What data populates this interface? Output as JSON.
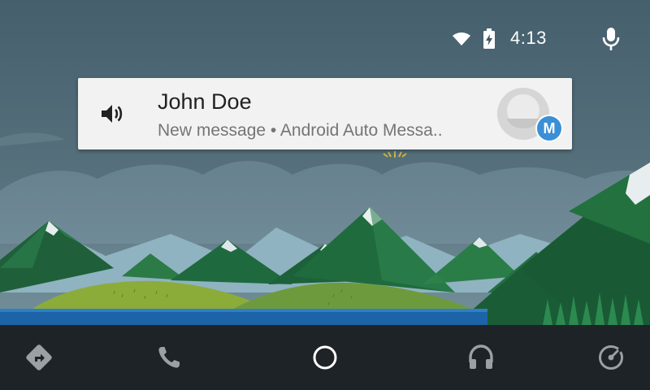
{
  "status_bar": {
    "time": "4:13",
    "icons": [
      "wifi-icon",
      "battery-charging-icon",
      "microphone-icon"
    ]
  },
  "notification": {
    "title": "John Doe",
    "text": "New message • Android Auto Messa..",
    "badge_letter": "M",
    "icons": [
      "volume-icon",
      "avatar-placeholder"
    ]
  },
  "nav_bar": {
    "items": [
      "navigation-icon",
      "phone-icon",
      "home-icon",
      "headphones-icon",
      "dashboard-gauge-icon"
    ]
  },
  "colors": {
    "badge": "#3b8fd6",
    "nav_bar": "#1d2326",
    "card": "#f2f2f2"
  }
}
